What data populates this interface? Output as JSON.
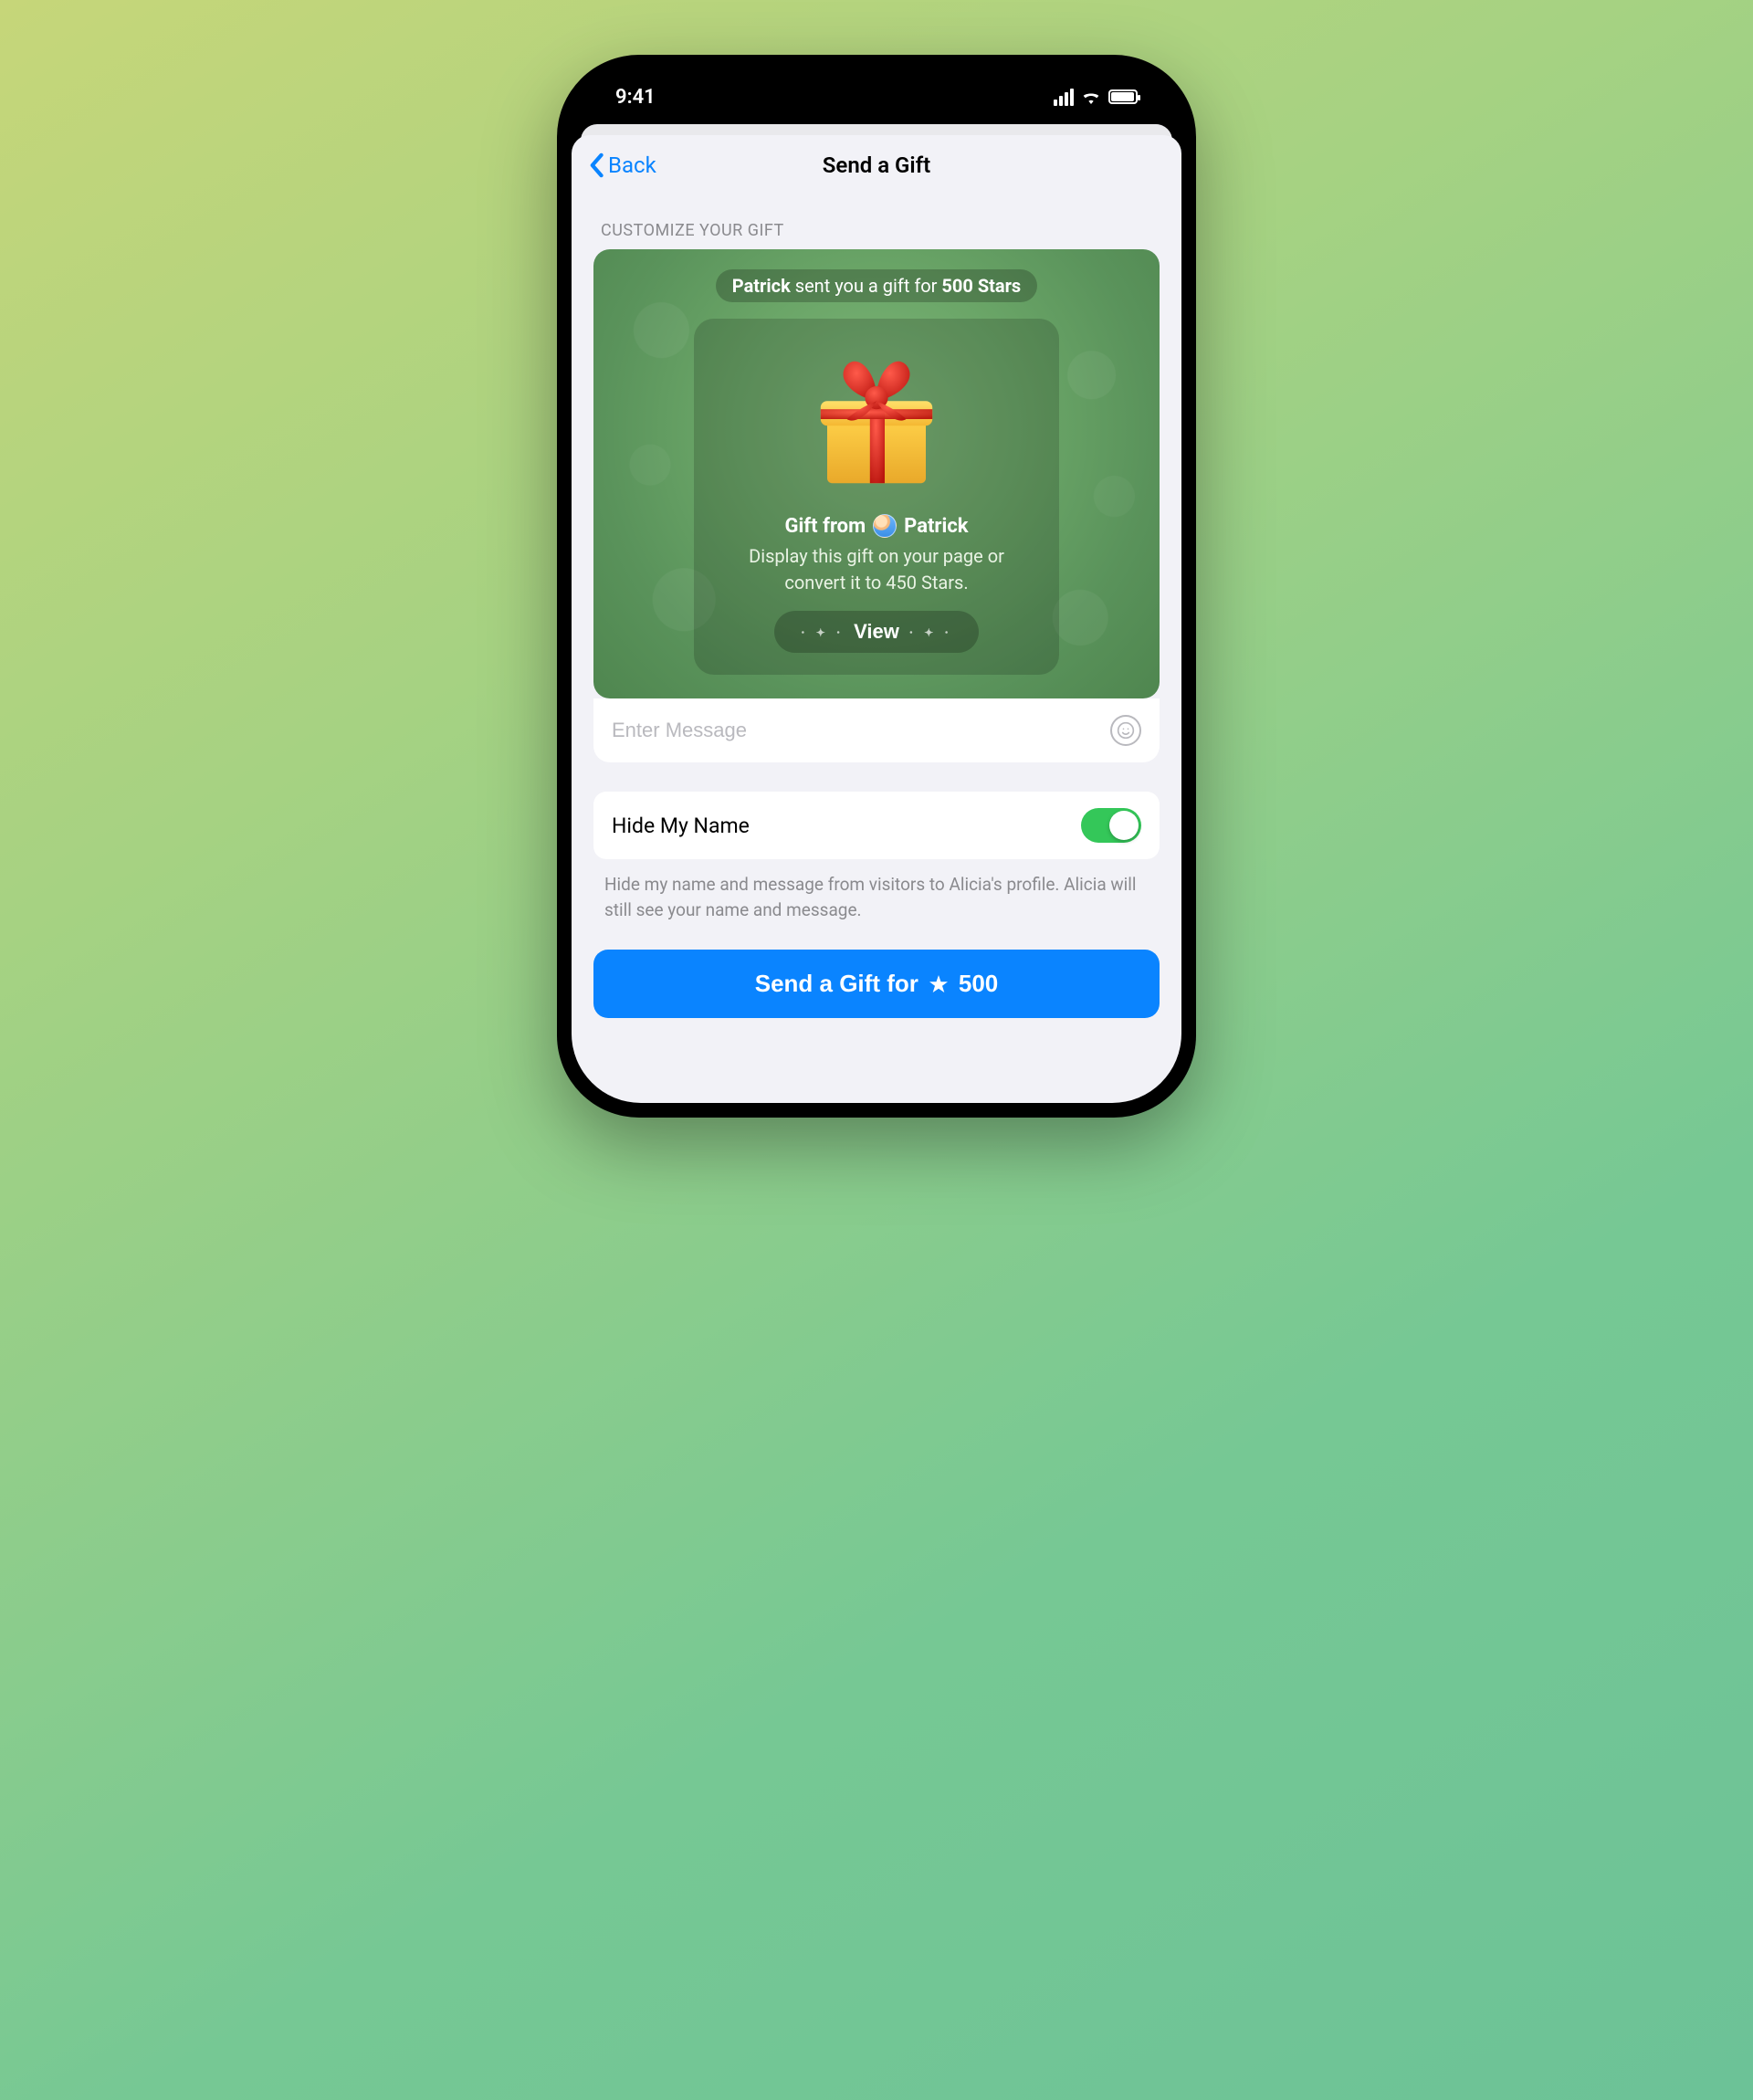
{
  "status": {
    "time": "9:41"
  },
  "nav": {
    "back": "Back",
    "title": "Send a Gift"
  },
  "section_label": "CUSTOMIZE YOUR GIFT",
  "preview": {
    "pill_sender": "Patrick",
    "pill_mid": " sent you a gift for ",
    "pill_amount": "500 Stars",
    "from_prefix": "Gift from",
    "from_name": "Patrick",
    "desc": "Display this gift on your page or convert it to 450 Stars.",
    "view": "View"
  },
  "message": {
    "placeholder": "Enter Message",
    "value": ""
  },
  "hide": {
    "label": "Hide My Name",
    "on": true,
    "note": "Hide my name and message from visitors to Alicia's profile. Alicia will still see your name and message."
  },
  "send": {
    "prefix": "Send a Gift for",
    "amount": "500"
  }
}
